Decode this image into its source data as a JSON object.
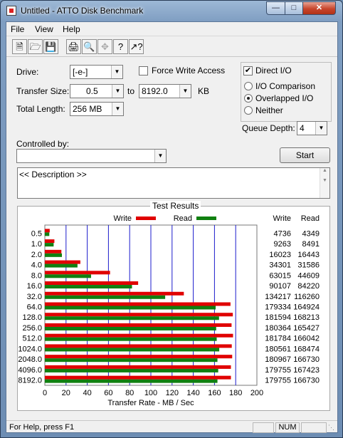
{
  "window": {
    "title": "Untitled - ATTO Disk Benchmark"
  },
  "menu": [
    "File",
    "View",
    "Help"
  ],
  "toolbar": [
    "new-icon",
    "open-icon",
    "save-icon",
    "print-icon",
    "print-preview-icon",
    "move-icon",
    "help-icon",
    "context-help-icon"
  ],
  "form": {
    "drive_label": "Drive:",
    "drive_value": "[-e-]",
    "force_write_label": "Force Write Access",
    "direct_io_label": "Direct I/O",
    "direct_io_checked": true,
    "transfer_size_label": "Transfer Size:",
    "transfer_from": "0.5",
    "to_label": "to",
    "transfer_to": "8192.0",
    "kb_label": "KB",
    "total_length_label": "Total Length:",
    "total_length_value": "256 MB",
    "io_comparison_label": "I/O Comparison",
    "overlapped_io_label": "Overlapped I/O",
    "neither_label": "Neither",
    "selected_mode": "Overlapped I/O",
    "queue_depth_label": "Queue Depth:",
    "queue_depth_value": "4",
    "controlled_by_label": "Controlled by:",
    "controlled_by_value": "",
    "start_label": "Start",
    "description": "<< Description >>"
  },
  "results": {
    "title": "Test Results",
    "write_col": "Write",
    "read_col": "Read"
  },
  "chart_data": {
    "type": "bar",
    "orientation": "horizontal",
    "xlabel": "Transfer Rate - MB / Sec",
    "xlim": [
      0,
      200
    ],
    "xticks": [
      0,
      20,
      40,
      60,
      80,
      100,
      120,
      140,
      160,
      180,
      200
    ],
    "categories": [
      "0.5",
      "1.0",
      "2.0",
      "4.0",
      "8.0",
      "16.0",
      "32.0",
      "64.0",
      "128.0",
      "256.0",
      "512.0",
      "1024.0",
      "2048.0",
      "4096.0",
      "8192.0"
    ],
    "series": [
      {
        "name": "Write",
        "color": "#e00000",
        "values": [
          4.6,
          9.0,
          15.6,
          33.5,
          61.5,
          88.0,
          131.1,
          175.1,
          177.3,
          176.1,
          177.5,
          176.3,
          176.7,
          175.5,
          175.5
        ],
        "labels": [
          "4736",
          "9263",
          "16023",
          "34301",
          "63015",
          "90107",
          "134217",
          "179334",
          "181594",
          "180364",
          "181784",
          "180561",
          "180967",
          "179755",
          "179755"
        ]
      },
      {
        "name": "Read",
        "color": "#108010",
        "values": [
          4.2,
          8.3,
          16.1,
          30.8,
          43.6,
          82.2,
          113.5,
          161.1,
          164.3,
          161.6,
          162.1,
          164.5,
          162.8,
          163.5,
          162.8
        ],
        "labels": [
          "4349",
          "8491",
          "16443",
          "31586",
          "44609",
          "84220",
          "116260",
          "164924",
          "168213",
          "165427",
          "166042",
          "168474",
          "166730",
          "167423",
          "166730"
        ]
      }
    ]
  },
  "status": {
    "help_text": "For Help, press F1",
    "num_label": "NUM"
  }
}
